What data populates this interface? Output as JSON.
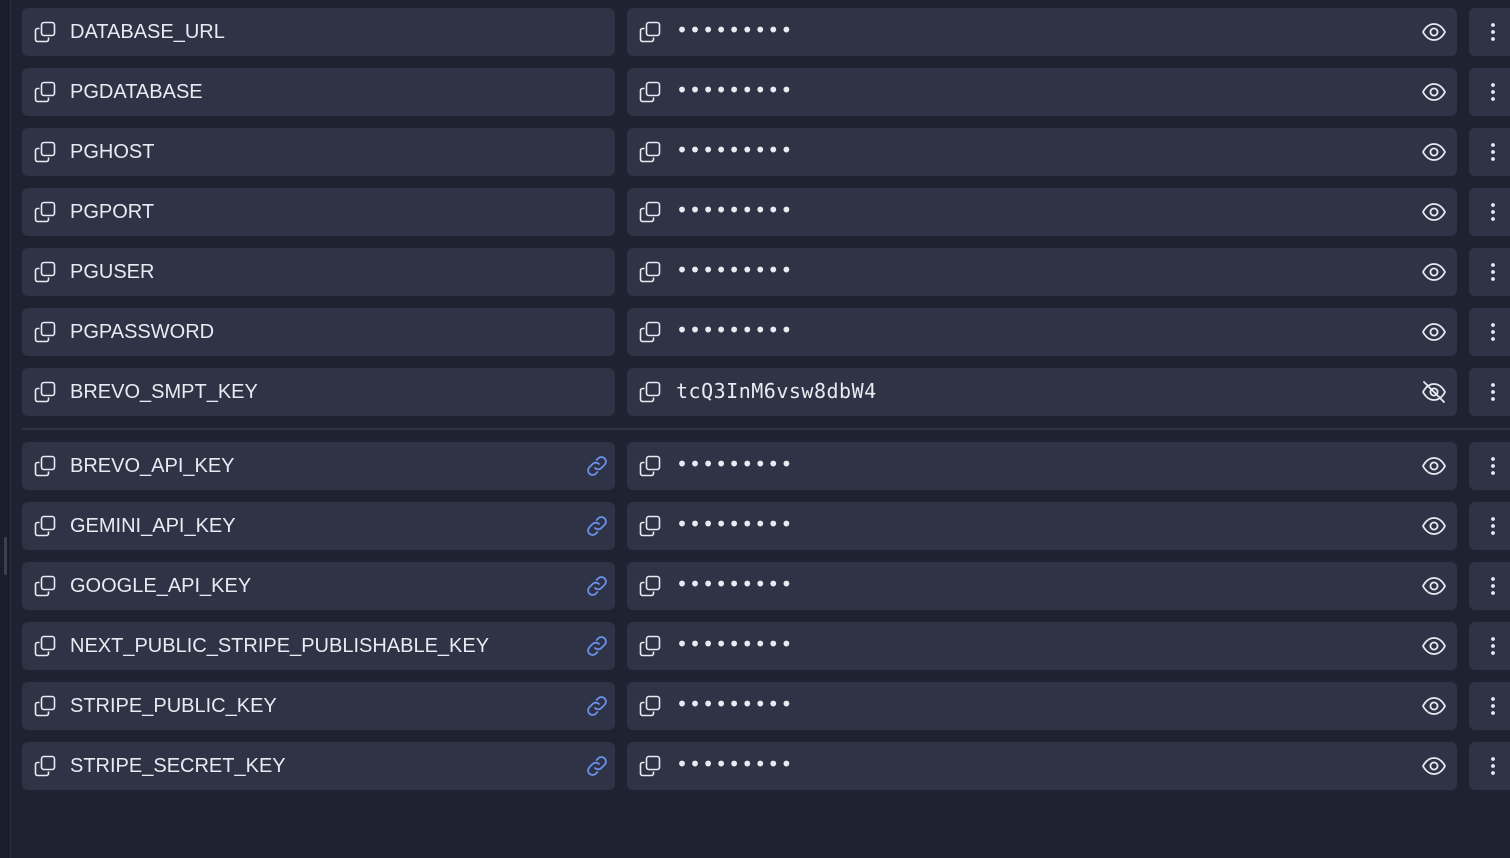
{
  "colors": {
    "background": "#1e2231",
    "cell": "#2e3345",
    "text": "#e9ebf2",
    "icon": "#e9ebf2",
    "link_accent": "#6b8fe8"
  },
  "icons": {
    "copy": "copy-icon",
    "link": "link-icon",
    "eye": "eye-icon",
    "eye_off": "eye-off-icon",
    "menu": "vertical-dots-icon"
  },
  "variables": [
    {
      "name": "DATABASE_URL",
      "value": "•••••••••",
      "revealed": false,
      "linked": false
    },
    {
      "name": "PGDATABASE",
      "value": "•••••••••",
      "revealed": false,
      "linked": false
    },
    {
      "name": "PGHOST",
      "value": "•••••••••",
      "revealed": false,
      "linked": false
    },
    {
      "name": "PGPORT",
      "value": "•••••••••",
      "revealed": false,
      "linked": false
    },
    {
      "name": "PGUSER",
      "value": "•••••••••",
      "revealed": false,
      "linked": false
    },
    {
      "name": "PGPASSWORD",
      "value": "•••••••••",
      "revealed": false,
      "linked": false
    },
    {
      "name": "BREVO_SMPT_KEY",
      "value": "tcQ3InM6vsw8dbW4",
      "revealed": true,
      "linked": false
    }
  ],
  "shared_variables": [
    {
      "name": "BREVO_API_KEY",
      "value": "•••••••••",
      "revealed": false,
      "linked": true
    },
    {
      "name": "GEMINI_API_KEY",
      "value": "•••••••••",
      "revealed": false,
      "linked": true
    },
    {
      "name": "GOOGLE_API_KEY",
      "value": "•••••••••",
      "revealed": false,
      "linked": true
    },
    {
      "name": "NEXT_PUBLIC_STRIPE_PUBLISHABLE_KEY",
      "value": "•••••••••",
      "revealed": false,
      "linked": true
    },
    {
      "name": "STRIPE_PUBLIC_KEY",
      "value": "•••••••••",
      "revealed": false,
      "linked": true
    },
    {
      "name": "STRIPE_SECRET_KEY",
      "value": "•••••••••",
      "revealed": false,
      "linked": true
    }
  ]
}
